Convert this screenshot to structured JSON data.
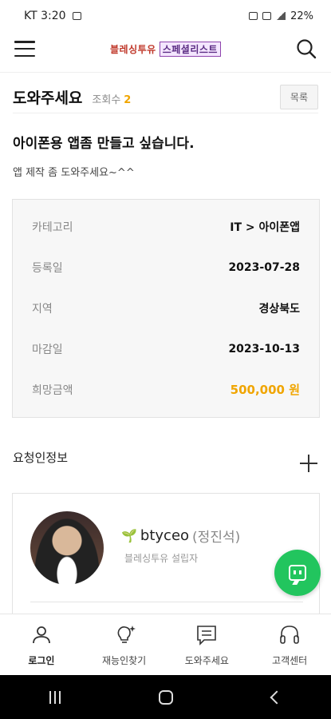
{
  "status_bar": {
    "carrier_time": "KT 3:20",
    "battery": "22%"
  },
  "header": {
    "logo_part1": "블레싱투유",
    "logo_part2": "스페셜리스트"
  },
  "page": {
    "title": "도와주세요",
    "views_label": "조회수",
    "views_count": "2",
    "list_button": "목록"
  },
  "post": {
    "title": "아이폰용 앱좀 만들고 싶습니다.",
    "body": "앱 제작 좀 도와주세요~^^",
    "info": [
      {
        "label": "카테고리",
        "value": "IT > 아이폰앱"
      },
      {
        "label": "등록일",
        "value": "2023-07-28"
      },
      {
        "label": "지역",
        "value": "경상북도"
      },
      {
        "label": "마감일",
        "value": "2023-10-13"
      },
      {
        "label": "희망금액",
        "value": "500,000 원"
      }
    ]
  },
  "requester": {
    "section_title": "요청인정보",
    "username": "btyceo",
    "real_name": "(정진석)",
    "role": "블레싱투유 설립자"
  },
  "bottom_nav": {
    "items": [
      {
        "label": "로그인",
        "icon": "user-icon"
      },
      {
        "label": "재능인찾기",
        "icon": "lightbulb-icon"
      },
      {
        "label": "도와주세요",
        "icon": "message-list-icon"
      },
      {
        "label": "고객센터",
        "icon": "headset-icon"
      }
    ]
  },
  "colors": {
    "accent": "#f0a500",
    "fab": "#22c55e"
  }
}
